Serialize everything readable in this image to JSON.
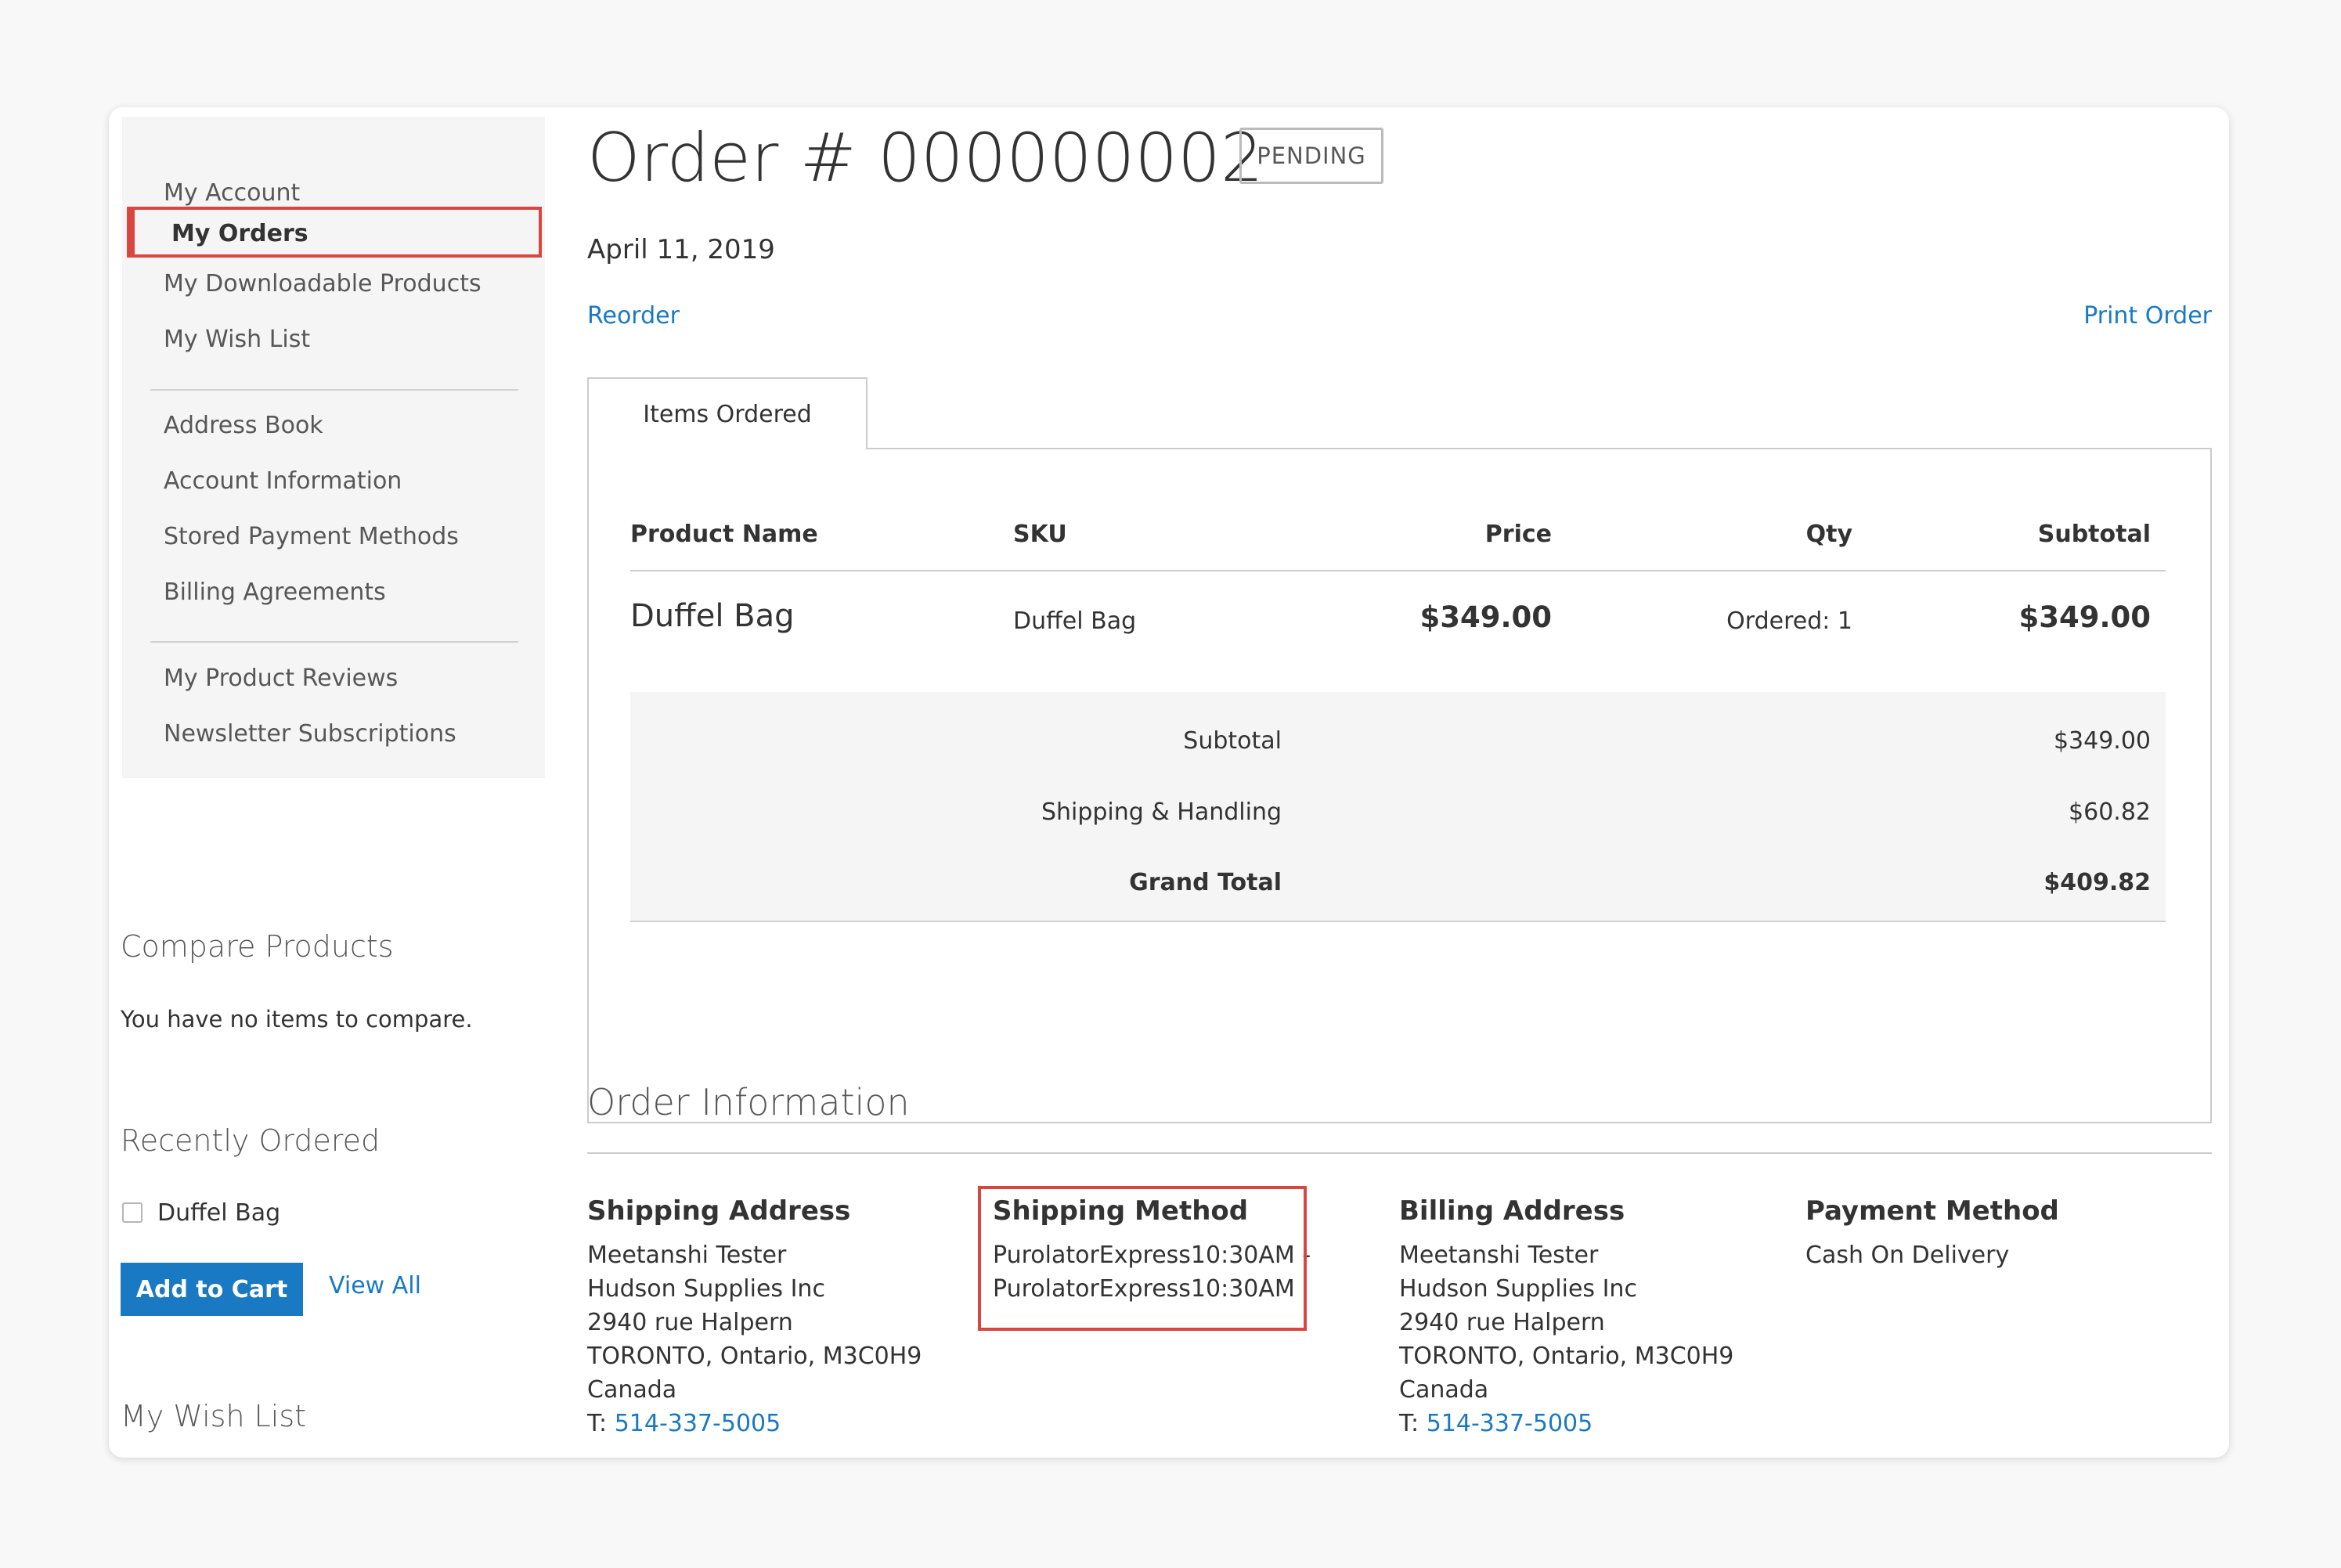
{
  "sidebar": {
    "nav_groups": [
      [
        "My Account",
        "My Orders",
        "My Downloadable Products",
        "My Wish List"
      ],
      [
        "Address Book",
        "Account Information",
        "Stored Payment Methods",
        "Billing Agreements"
      ],
      [
        "My Product Reviews",
        "Newsletter Subscriptions"
      ]
    ],
    "active_item": "My Orders",
    "compare": {
      "title": "Compare Products",
      "empty_text": "You have no items to compare."
    },
    "recently_ordered": {
      "title": "Recently Ordered",
      "items": [
        "Duffel Bag"
      ],
      "add_to_cart_label": "Add to Cart",
      "view_all_label": "View All"
    },
    "wishlist_title": "My Wish List"
  },
  "order": {
    "title": "Order # 000000002",
    "status": "PENDING",
    "date": "April 11, 2019",
    "reorder_label": "Reorder",
    "print_label": "Print Order"
  },
  "tab_label": "Items Ordered",
  "items_table": {
    "columns": [
      "Product Name",
      "SKU",
      "Price",
      "Qty",
      "Subtotal"
    ],
    "rows": [
      {
        "name": "Duffel Bag",
        "sku": "Duffel Bag",
        "price": "$349.00",
        "qty": "Ordered: 1",
        "subtotal": "$349.00"
      }
    ]
  },
  "totals": [
    {
      "label": "Subtotal",
      "value": "$349.00"
    },
    {
      "label": "Shipping & Handling",
      "value": "$60.82"
    },
    {
      "label": "Grand Total",
      "value": "$409.82"
    }
  ],
  "order_info": {
    "title": "Order Information",
    "shipping_address": {
      "title": "Shipping Address",
      "lines": [
        "Meetanshi Tester",
        "Hudson Supplies Inc",
        "2940 rue Halpern",
        "TORONTO, Ontario, M3C0H9",
        "Canada"
      ],
      "phone_prefix": "T: ",
      "phone": "514-337-5005"
    },
    "shipping_method": {
      "title": "Shipping Method",
      "lines": [
        "PurolatorExpress10:30AM -",
        "PurolatorExpress10:30AM"
      ]
    },
    "billing_address": {
      "title": "Billing Address",
      "lines": [
        "Meetanshi Tester",
        "Hudson Supplies Inc",
        "2940 rue Halpern",
        "TORONTO, Ontario, M3C0H9",
        "Canada"
      ],
      "phone_prefix": "T: ",
      "phone": "514-337-5005"
    },
    "payment_method": {
      "title": "Payment Method",
      "lines": [
        "Cash On Delivery"
      ]
    }
  },
  "colors": {
    "link": "#1979c3",
    "highlight": "#d9453f",
    "button": "#1979c3"
  }
}
